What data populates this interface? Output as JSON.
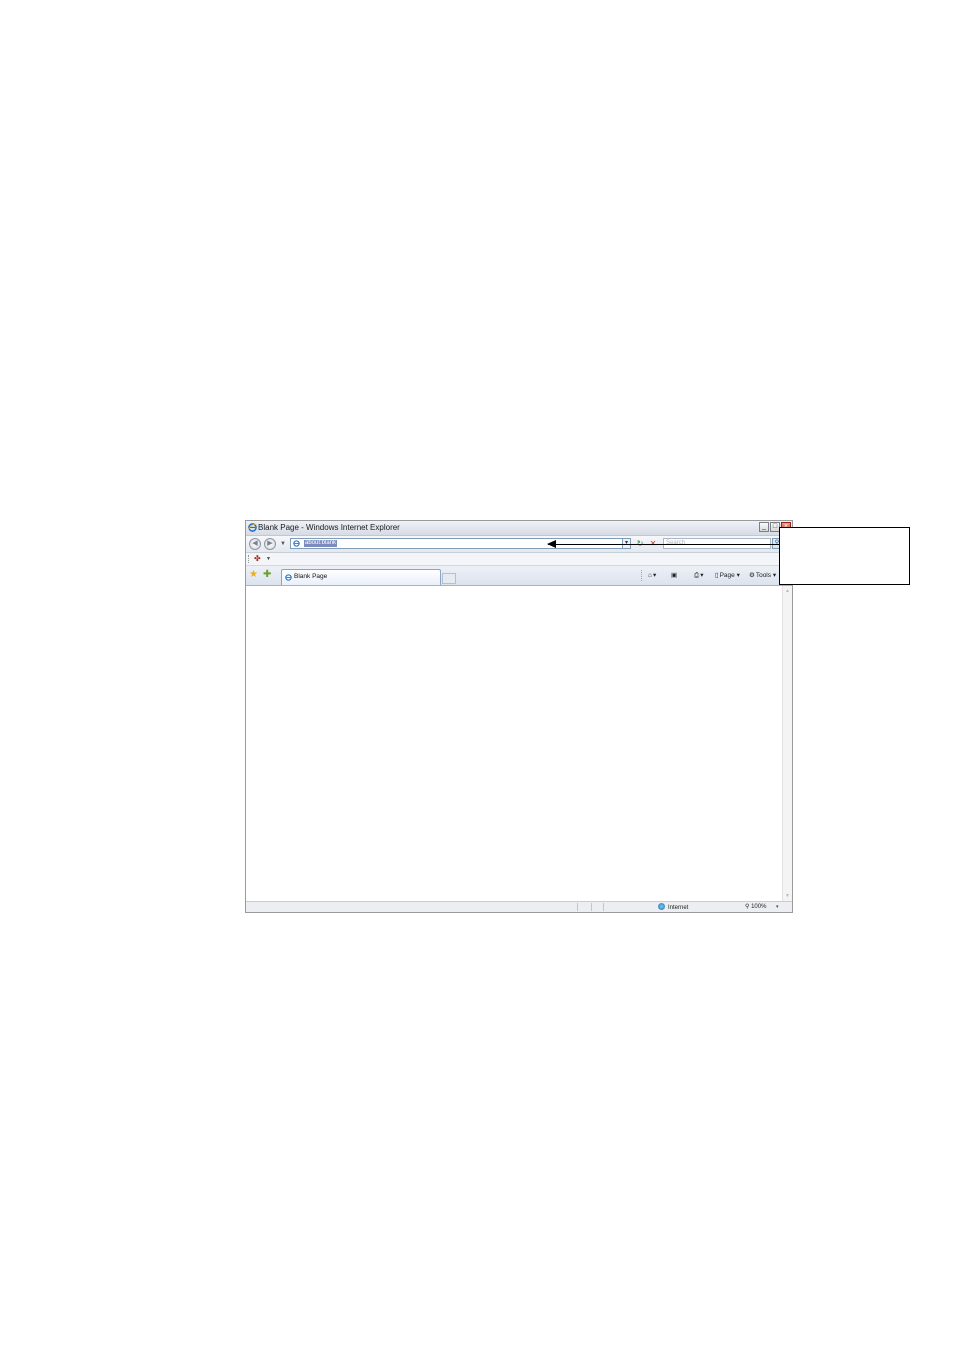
{
  "window": {
    "title": "Blank Page - Windows Internet Explorer",
    "buttons": {
      "minimize": "_",
      "maximize": "□",
      "close": "×"
    }
  },
  "navbar": {
    "address_value": "about:blank",
    "search_placeholder": "Search"
  },
  "tabs": [
    {
      "label": "Blank Page"
    }
  ],
  "command_bar": {
    "page_label": "Page",
    "tools_label": "Tools"
  },
  "statusbar": {
    "zone": "Internet",
    "zoom": "100%"
  },
  "icons": [
    "ie-logo-icon",
    "back-icon",
    "forward-icon",
    "refresh-icon",
    "stop-icon",
    "search-icon",
    "favorites-star-icon",
    "add-favorites-icon",
    "home-icon",
    "feeds-icon",
    "print-icon",
    "page-icon",
    "tools-gear-icon",
    "globe-icon",
    "zoom-icon"
  ]
}
